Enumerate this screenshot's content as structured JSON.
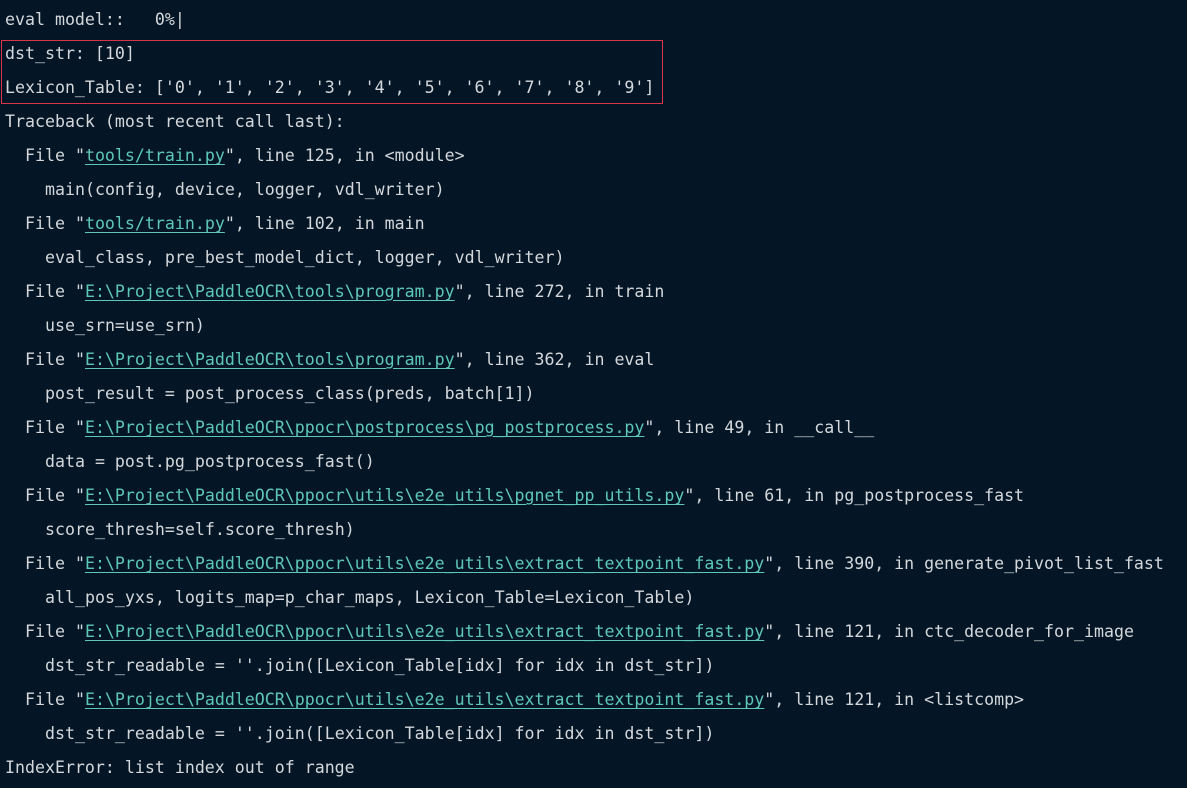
{
  "progress_line": "eval model::   0%|",
  "highlight": {
    "dst_str_line": "dst_str: [10]",
    "lexicon_line": "Lexicon_Table: ['0', '1', '2', '3', '4', '5', '6', '7', '8', '9']",
    "border_color": "#d9354a"
  },
  "traceback_header": "Traceback (most recent call last):",
  "frames": [
    {
      "prefix": "File \"",
      "path": "tools/train.py",
      "suffix": "\", line 125, in <module>",
      "code": "main(config, device, logger, vdl_writer)"
    },
    {
      "prefix": "File \"",
      "path": "tools/train.py",
      "suffix": "\", line 102, in main",
      "code": "eval_class, pre_best_model_dict, logger, vdl_writer)"
    },
    {
      "prefix": "File \"",
      "path": "E:\\Project\\PaddleOCR\\tools\\program.py",
      "suffix": "\", line 272, in train",
      "code": "use_srn=use_srn)"
    },
    {
      "prefix": "File \"",
      "path": "E:\\Project\\PaddleOCR\\tools\\program.py",
      "suffix": "\", line 362, in eval",
      "code": "post_result = post_process_class(preds, batch[1])"
    },
    {
      "prefix": "File \"",
      "path": "E:\\Project\\PaddleOCR\\ppocr\\postprocess\\pg_postprocess.py",
      "suffix": "\", line 49, in __call__",
      "code": "data = post.pg_postprocess_fast()"
    },
    {
      "prefix": "File \"",
      "path": "E:\\Project\\PaddleOCR\\ppocr\\utils\\e2e_utils\\pgnet_pp_utils.py",
      "suffix": "\", line 61, in pg_postprocess_fast",
      "code": "score_thresh=self.score_thresh)"
    },
    {
      "prefix": "File \"",
      "path": "E:\\Project\\PaddleOCR\\ppocr\\utils\\e2e_utils\\extract_textpoint_fast.py",
      "suffix": "\", line 390, in generate_pivot_list_fast",
      "code": "all_pos_yxs, logits_map=p_char_maps, Lexicon_Table=Lexicon_Table)"
    },
    {
      "prefix": "File \"",
      "path": "E:\\Project\\PaddleOCR\\ppocr\\utils\\e2e_utils\\extract_textpoint_fast.py",
      "suffix": "\", line 121, in ctc_decoder_for_image",
      "code": "dst_str_readable = ''.join([Lexicon_Table[idx] for idx in dst_str])"
    },
    {
      "prefix": "File \"",
      "path": "E:\\Project\\PaddleOCR\\ppocr\\utils\\e2e_utils\\extract_textpoint_fast.py",
      "suffix": "\", line 121, in <listcomp>",
      "code": "dst_str_readable = ''.join([Lexicon_Table[idx] for idx in dst_str])"
    }
  ],
  "error_line": "IndexError: list index out of range",
  "colors": {
    "background": "#041626",
    "text": "#d4d8dc",
    "link": "#5ec8b6"
  }
}
